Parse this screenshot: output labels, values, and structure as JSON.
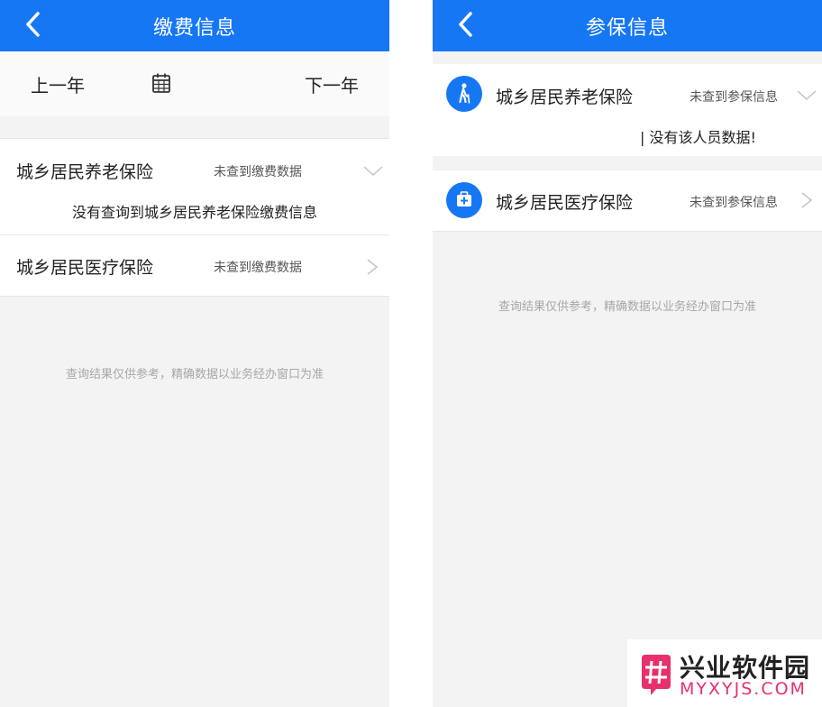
{
  "left": {
    "title": "缴费信息",
    "prev_year": "上一年",
    "next_year": "下一年",
    "items": [
      {
        "name": "城乡居民养老保险",
        "status": "未查到缴费数据",
        "message": "没有查询到城乡居民养老保险缴费信息",
        "chevron": "chevron-down-icon"
      },
      {
        "name": "城乡居民医疗保险",
        "status": "未查到缴费数据",
        "chevron": "chevron-right-icon"
      }
    ],
    "note": "查询结果仅供参考，精确数据以业务经办窗口为准"
  },
  "right": {
    "title": "参保信息",
    "items": [
      {
        "name": "城乡居民养老保险",
        "status": "未查到参保信息",
        "message": "| 没有该人员数据!",
        "icon": "elderly-person-icon",
        "chevron": "chevron-down-icon"
      },
      {
        "name": "城乡居民医疗保险",
        "status": "未查到参保信息",
        "icon": "medical-kit-icon",
        "chevron": "chevron-right-icon"
      }
    ],
    "note": "查询结果仅供参考，精确数据以业务经办窗口为准"
  },
  "watermark": {
    "name_cn": "兴业软件园",
    "name_en": "MYXYJS.COM"
  },
  "colors": {
    "header": "#1677f5",
    "background": "#f3f3f4",
    "watermark_accent": "#e8306b"
  }
}
